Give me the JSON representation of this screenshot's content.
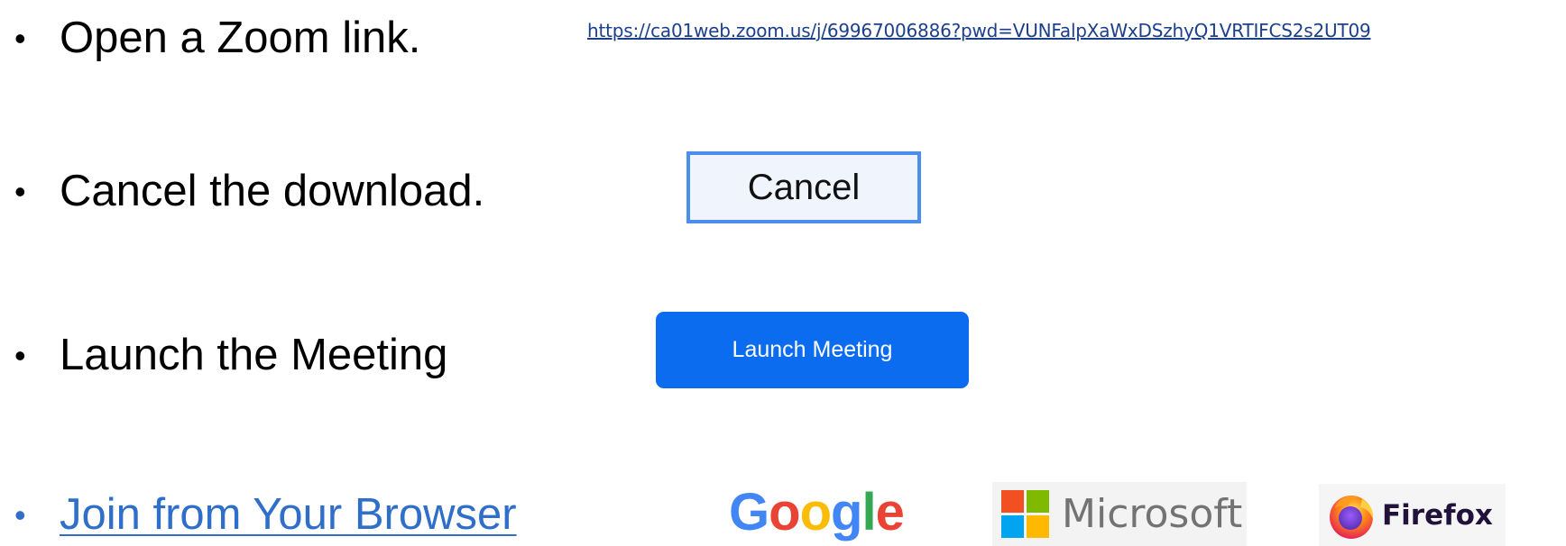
{
  "steps": [
    {
      "bullet": "•",
      "text": "Open a Zoom link."
    },
    {
      "bullet": "•",
      "text": "Cancel the download."
    },
    {
      "bullet": "•",
      "text": "Launch the Meeting"
    },
    {
      "bullet": "•",
      "text": "Join from Your Browser"
    }
  ],
  "zoom_link": {
    "url": "https://ca01web.zoom.us/j/69967006886?pwd=VUNFalpXaWxDSzhyQ1VRTIFCS2s2UT09"
  },
  "cancel_button": {
    "label": "Cancel"
  },
  "launch_button": {
    "label": "Launch Meeting",
    "color": "#0b6cf0"
  },
  "browsers": {
    "google": {
      "letters": [
        "G",
        "o",
        "o",
        "g",
        "l",
        "e"
      ]
    },
    "microsoft": {
      "label": "Microsoft",
      "icon": "microsoft-windows-logo"
    },
    "firefox": {
      "label": "Firefox",
      "icon": "firefox-logo"
    }
  },
  "colors": {
    "link": "#2f6fc9",
    "cancel_border": "#4b8ef0",
    "cancel_background": "#eff4fd"
  }
}
